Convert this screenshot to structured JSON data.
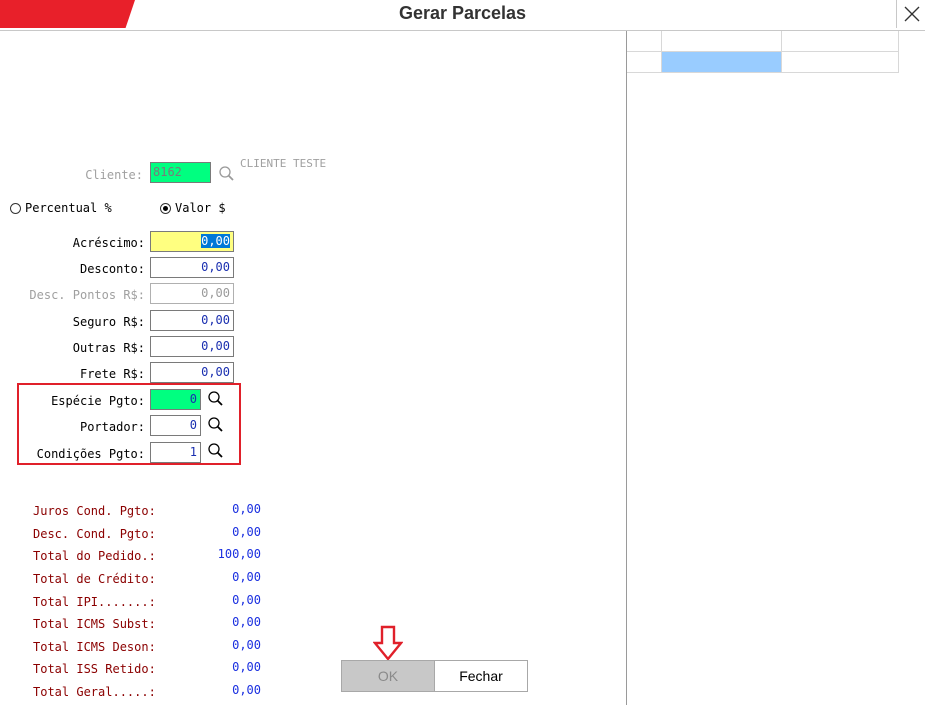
{
  "window": {
    "title": "Gerar Parcelas"
  },
  "client": {
    "label": "Cliente:",
    "code": "8162",
    "name": "CLIENTE TESTE"
  },
  "mode": {
    "percent_label": "Percentual %",
    "value_label": "Valor $",
    "selected": "Valor $"
  },
  "fields": {
    "acrescimo": {
      "label": "Acréscimo:",
      "value": "0,00"
    },
    "desconto": {
      "label": "Desconto:",
      "value": "0,00"
    },
    "desc_pontos": {
      "label": "Desc. Pontos R$:",
      "value": "0,00"
    },
    "seguro": {
      "label": "Seguro R$:",
      "value": "0,00"
    },
    "outras": {
      "label": "Outras R$:",
      "value": "0,00"
    },
    "frete": {
      "label": "Frete R$:",
      "value": "0,00"
    },
    "especie": {
      "label": "Espécie Pgto:",
      "value": "0"
    },
    "portador": {
      "label": "Portador:",
      "value": "0"
    },
    "condicoes": {
      "label": "Condições Pgto:",
      "value": "1"
    }
  },
  "totals": [
    {
      "label": "Juros Cond. Pgto:",
      "value": "0,00"
    },
    {
      "label": "Desc. Cond. Pgto:",
      "value": "0,00"
    },
    {
      "label": "Total do Pedido.:",
      "value": "100,00"
    },
    {
      "label": "Total de Crédito:",
      "value": "0,00"
    },
    {
      "label": "Total IPI.......:",
      "value": "0,00"
    },
    {
      "label": "Total ICMS Subst:",
      "value": "0,00"
    },
    {
      "label": "Total ICMS Deson:",
      "value": "0,00"
    },
    {
      "label": "Total ISS Retido:",
      "value": "0,00"
    },
    {
      "label": "Total Geral.....:",
      "value": "0,00"
    }
  ],
  "buttons": {
    "ok": "OK",
    "close": "Fechar"
  },
  "colors": {
    "accent": "#e8202a",
    "grid_selected": "#99ccff",
    "field_green": "#00ff80",
    "field_yellow": "#ffff80"
  },
  "icons": {
    "close": "close-icon",
    "search": "magnifier-icon",
    "pointer": "down-arrow-icon"
  }
}
